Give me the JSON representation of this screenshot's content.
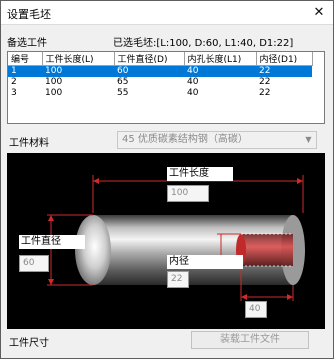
{
  "window": {
    "title": "设置毛坯",
    "close_glyph": "✕"
  },
  "section": {
    "candidates_label": "备选工件",
    "selected_label": "已选毛坯:[L:100, D:60, L1:40, D1:22]"
  },
  "table": {
    "headers": [
      "编号",
      "工件长度(L)",
      "工件直径(D)",
      "内孔长度(L1)",
      "内径(D1)"
    ],
    "rows": [
      [
        "1",
        "100",
        "60",
        "40",
        "22"
      ],
      [
        "2",
        "100",
        "65",
        "40",
        "22"
      ],
      [
        "3",
        "100",
        "55",
        "40",
        "22"
      ]
    ],
    "selected_index": 0
  },
  "material": {
    "label": "工件材料",
    "value": "45 优质碳素结构钢（高碳）",
    "arrow": "▼"
  },
  "diagram": {
    "length_label": "工件长度",
    "length_value": "100",
    "diameter_label": "工件直径",
    "diameter_value": "60",
    "inner_diameter_label": "内径",
    "inner_diameter_value": "22",
    "inner_length_value": "40"
  },
  "footer": {
    "size_label": "工件尺寸",
    "load_button": "装载工件文件"
  }
}
